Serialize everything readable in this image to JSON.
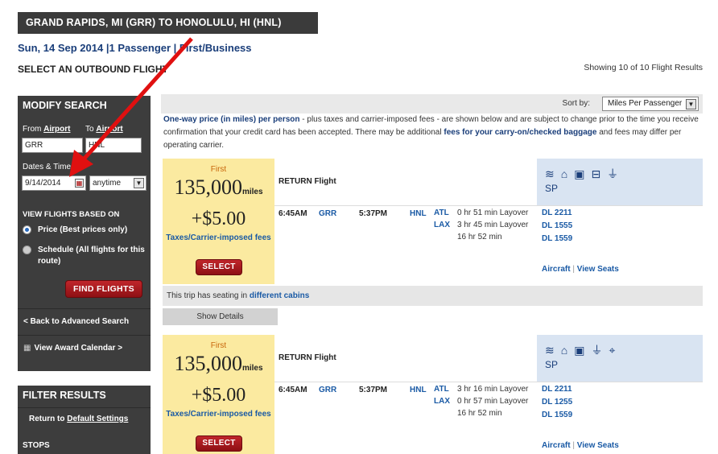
{
  "header": {
    "route": "GRAND RAPIDS, MI (GRR) TO HONOLULU, HI (HNL)",
    "trip_info": "Sun, 14 Sep 2014 |1 Passenger | First/Business",
    "select_heading": "SELECT AN OUTBOUND FLIGHT",
    "results_count": "Showing 10 of 10 Flight Results"
  },
  "modify_search": {
    "title": "MODIFY SEARCH",
    "from_label": "From",
    "to_label": "To",
    "airport_link": "Airport",
    "from_value": "GRR",
    "to_value": "HNL",
    "date_time_label": "Dates & Time",
    "date_value": "9/14/2014",
    "time_value": "anytime",
    "view_flights_label": "VIEW FLIGHTS BASED ON",
    "price_option": "Price (Best prices only)",
    "schedule_option": "Schedule (All flights for this route)",
    "find_button": "FIND FLIGHTS",
    "back_link": "< Back to Advanced Search",
    "calendar_link": "View Award Calendar >"
  },
  "filter": {
    "title": "FILTER RESULTS",
    "return_prefix": "Return to",
    "default_link": "Default Settings",
    "stops_label": "STOPS"
  },
  "sort": {
    "label": "Sort by:",
    "value": "Miles Per Passenger"
  },
  "notice": {
    "lead": "One-way price (in miles) per person",
    "body": " - plus taxes and carrier-imposed fees - are shown below and are subject to change prior to the time you receive confirmation that your credit card has been accepted. There may be additional ",
    "fees_link": "fees for your carry-on/checked baggage",
    "tail": " and fees may differ per operating carrier."
  },
  "flights": [
    {
      "cabin": "First",
      "miles": "135,000",
      "miles_unit": "miles",
      "fee": "+$5.00",
      "taxes_label": "Taxes/Carrier-imposed fees",
      "select_label": "SELECT",
      "flight_type": "RETURN Flight",
      "depart_time": "6:45AM",
      "origin": "GRR",
      "arrive_time": "5:37PM",
      "destination": "HNL",
      "layovers": [
        {
          "code": "ATL",
          "time": "0 hr 51 min Layover"
        },
        {
          "code": "LAX",
          "time": "3 hr 45 min Layover"
        }
      ],
      "total_duration": "16 hr 52 min",
      "flight_numbers": [
        "DL 2211",
        "DL 1555",
        "DL 1559"
      ],
      "aircraft_link": "Aircraft",
      "seats_link": "View Seats",
      "seat_code": "SP",
      "amenity_icons": [
        "wifi-icon",
        "power-seat-icon",
        "entertainment-icon",
        "flat-bed-icon",
        "power-plug-icon"
      ],
      "seating_prefix": "This trip has seating in",
      "seating_link": "different cabins",
      "details_label": "Show Details"
    },
    {
      "cabin": "First",
      "miles": "135,000",
      "miles_unit": "miles",
      "fee": "+$5.00",
      "taxes_label": "Taxes/Carrier-imposed fees",
      "select_label": "SELECT",
      "flight_type": "RETURN Flight",
      "depart_time": "6:45AM",
      "origin": "GRR",
      "arrive_time": "5:37PM",
      "destination": "HNL",
      "layovers": [
        {
          "code": "ATL",
          "time": "3 hr 16 min Layover"
        },
        {
          "code": "LAX",
          "time": "0 hr 57 min Layover"
        }
      ],
      "total_duration": "16 hr 52 min",
      "flight_numbers": [
        "DL 2211",
        "DL 1255",
        "DL 1559"
      ],
      "aircraft_link": "Aircraft",
      "seats_link": "View Seats",
      "seat_code": "SP",
      "amenity_icons": [
        "wifi-icon",
        "power-seat-icon",
        "entertainment-icon",
        "power-plug-icon",
        "satellite-icon"
      ]
    }
  ],
  "colors": {
    "banner": "#3b3b3b",
    "sidebar": "#3d3d3d",
    "price_bg": "#fbeaa0",
    "amenity_bg": "#d9e4f2",
    "link_blue": "#1a5aa5",
    "cabin_orange": "#c8660b",
    "button_red": "#a81a1f",
    "annotation_arrow": "#e01010"
  }
}
